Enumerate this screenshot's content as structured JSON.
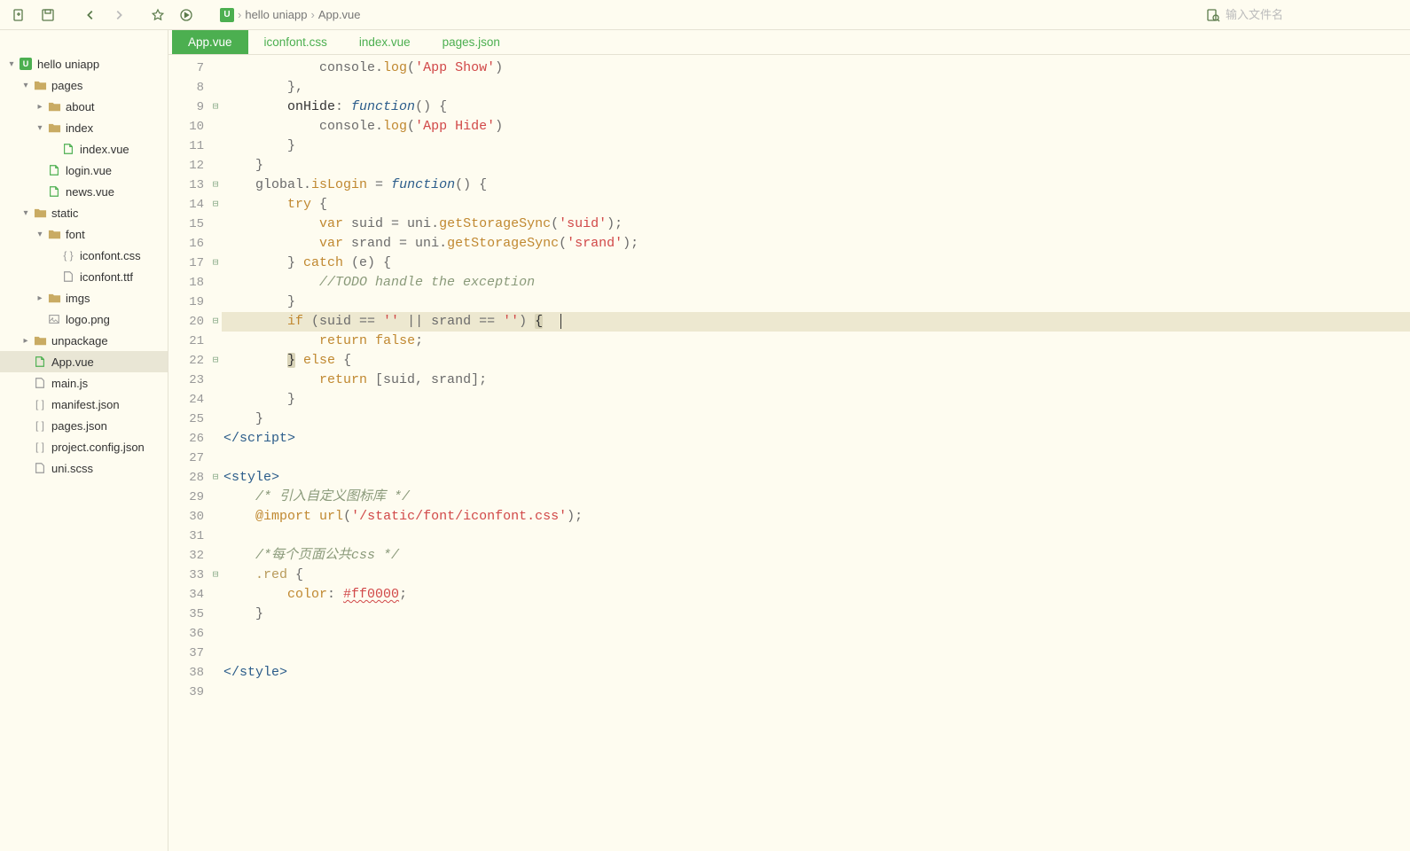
{
  "toolbar": {
    "search_placeholder": "输入文件名"
  },
  "breadcrumb": {
    "project": "hello uniapp",
    "file": "App.vue",
    "sep": "›"
  },
  "sidebar": {
    "project": "hello uniapp",
    "tree": [
      {
        "indent": 0,
        "arrow": "▾",
        "icon": "proj",
        "label": "hello uniapp"
      },
      {
        "indent": 1,
        "arrow": "▾",
        "icon": "folder",
        "label": "pages"
      },
      {
        "indent": 2,
        "arrow": "▸",
        "icon": "folder",
        "label": "about"
      },
      {
        "indent": 2,
        "arrow": "▾",
        "icon": "folder",
        "label": "index"
      },
      {
        "indent": 3,
        "arrow": "",
        "icon": "vue",
        "label": "index.vue"
      },
      {
        "indent": 2,
        "arrow": "",
        "icon": "vue",
        "label": "login.vue"
      },
      {
        "indent": 2,
        "arrow": "",
        "icon": "vue",
        "label": "news.vue"
      },
      {
        "indent": 1,
        "arrow": "▾",
        "icon": "folder",
        "label": "static"
      },
      {
        "indent": 2,
        "arrow": "▾",
        "icon": "folder",
        "label": "font"
      },
      {
        "indent": 3,
        "arrow": "",
        "icon": "css",
        "label": "iconfont.css"
      },
      {
        "indent": 3,
        "arrow": "",
        "icon": "file",
        "label": "iconfont.ttf"
      },
      {
        "indent": 2,
        "arrow": "▸",
        "icon": "folder",
        "label": "imgs"
      },
      {
        "indent": 2,
        "arrow": "",
        "icon": "img",
        "label": "logo.png"
      },
      {
        "indent": 1,
        "arrow": "▸",
        "icon": "folder",
        "label": "unpackage"
      },
      {
        "indent": 1,
        "arrow": "",
        "icon": "vue",
        "label": "App.vue",
        "active": true
      },
      {
        "indent": 1,
        "arrow": "",
        "icon": "js",
        "label": "main.js"
      },
      {
        "indent": 1,
        "arrow": "",
        "icon": "json",
        "label": "manifest.json"
      },
      {
        "indent": 1,
        "arrow": "",
        "icon": "json",
        "label": "pages.json"
      },
      {
        "indent": 1,
        "arrow": "",
        "icon": "json",
        "label": "project.config.json"
      },
      {
        "indent": 1,
        "arrow": "",
        "icon": "scss",
        "label": "uni.scss"
      }
    ]
  },
  "tabs": [
    {
      "label": "App.vue",
      "active": true
    },
    {
      "label": "iconfont.css"
    },
    {
      "label": "index.vue"
    },
    {
      "label": "pages.json"
    }
  ],
  "code": {
    "first_line_no": 7,
    "highlighted_index": 13,
    "lines": [
      {
        "fold": "",
        "segs": [
          [
            "            console.",
            "c-default"
          ],
          [
            "log",
            "c-method"
          ],
          [
            "(",
            "c-punct"
          ],
          [
            "'App Show'",
            "c-string"
          ],
          [
            ")",
            "c-punct"
          ]
        ]
      },
      {
        "fold": "",
        "segs": [
          [
            "        },",
            "c-punct"
          ]
        ]
      },
      {
        "fold": "⊟",
        "segs": [
          [
            "        onHide",
            "c-prop"
          ],
          [
            ": ",
            "c-punct"
          ],
          [
            "function",
            "c-func"
          ],
          [
            "() {",
            "c-punct"
          ]
        ]
      },
      {
        "fold": "",
        "segs": [
          [
            "            console.",
            "c-default"
          ],
          [
            "log",
            "c-method"
          ],
          [
            "(",
            "c-punct"
          ],
          [
            "'App Hide'",
            "c-string"
          ],
          [
            ")",
            "c-punct"
          ]
        ]
      },
      {
        "fold": "",
        "segs": [
          [
            "        }",
            "c-punct"
          ]
        ]
      },
      {
        "fold": "",
        "segs": [
          [
            "    }",
            "c-punct"
          ]
        ]
      },
      {
        "fold": "⊟",
        "segs": [
          [
            "    global.",
            "c-default"
          ],
          [
            "isLogin",
            "c-method"
          ],
          [
            " = ",
            "c-punct"
          ],
          [
            "function",
            "c-func"
          ],
          [
            "() {",
            "c-punct"
          ]
        ]
      },
      {
        "fold": "⊟",
        "segs": [
          [
            "        ",
            "c-default"
          ],
          [
            "try",
            "c-keyword2"
          ],
          [
            " {",
            "c-punct"
          ]
        ]
      },
      {
        "fold": "",
        "segs": [
          [
            "            ",
            "c-default"
          ],
          [
            "var",
            "c-keyword2"
          ],
          [
            " suid = uni.",
            "c-default"
          ],
          [
            "getStorageSync",
            "c-method"
          ],
          [
            "(",
            "c-punct"
          ],
          [
            "'suid'",
            "c-string"
          ],
          [
            ");",
            "c-punct"
          ]
        ]
      },
      {
        "fold": "",
        "segs": [
          [
            "            ",
            "c-default"
          ],
          [
            "var",
            "c-keyword2"
          ],
          [
            " srand = uni.",
            "c-default"
          ],
          [
            "getStorageSync",
            "c-method"
          ],
          [
            "(",
            "c-punct"
          ],
          [
            "'srand'",
            "c-string"
          ],
          [
            ");",
            "c-punct"
          ]
        ]
      },
      {
        "fold": "⊟",
        "segs": [
          [
            "        } ",
            "c-punct"
          ],
          [
            "catch",
            "c-keyword2"
          ],
          [
            " (e) {",
            "c-punct"
          ]
        ]
      },
      {
        "fold": "",
        "segs": [
          [
            "            ",
            "c-default"
          ],
          [
            "//TODO handle the exception",
            "c-comment"
          ]
        ]
      },
      {
        "fold": "",
        "segs": [
          [
            "        }",
            "c-punct"
          ]
        ]
      },
      {
        "fold": "⊟",
        "segs": [
          [
            "        ",
            "c-default"
          ],
          [
            "if",
            "c-keyword2"
          ],
          [
            " (suid == ",
            "c-default"
          ],
          [
            "''",
            "c-string"
          ],
          [
            " || srand == ",
            "c-default"
          ],
          [
            "''",
            "c-string"
          ],
          [
            ") ",
            "c-default"
          ],
          [
            "{",
            "bracket-match"
          ]
        ]
      },
      {
        "fold": "",
        "segs": [
          [
            "            ",
            "c-default"
          ],
          [
            "return",
            "c-keyword2"
          ],
          [
            " ",
            "c-default"
          ],
          [
            "false",
            "c-keyword2"
          ],
          [
            ";",
            "c-punct"
          ]
        ]
      },
      {
        "fold": "⊟",
        "segs": [
          [
            "        ",
            "c-default"
          ],
          [
            "}",
            "bracket-match"
          ],
          [
            " ",
            "c-default"
          ],
          [
            "else",
            "c-keyword2"
          ],
          [
            " {",
            "c-punct"
          ]
        ]
      },
      {
        "fold": "",
        "segs": [
          [
            "            ",
            "c-default"
          ],
          [
            "return",
            "c-keyword2"
          ],
          [
            " [suid, srand];",
            "c-default"
          ]
        ]
      },
      {
        "fold": "",
        "segs": [
          [
            "        }",
            "c-punct"
          ]
        ]
      },
      {
        "fold": "",
        "segs": [
          [
            "    }",
            "c-punct"
          ]
        ]
      },
      {
        "fold": "",
        "segs": [
          [
            "</",
            "c-tag"
          ],
          [
            "script",
            "c-tag"
          ],
          [
            ">",
            "c-tag"
          ]
        ]
      },
      {
        "fold": "",
        "segs": [
          [
            "",
            ""
          ]
        ]
      },
      {
        "fold": "⊟",
        "segs": [
          [
            "<",
            "c-tag"
          ],
          [
            "style",
            "c-tag"
          ],
          [
            ">",
            "c-tag"
          ]
        ]
      },
      {
        "fold": "",
        "segs": [
          [
            "    ",
            "c-default"
          ],
          [
            "/* 引入自定义图标库 */",
            "c-comment"
          ]
        ]
      },
      {
        "fold": "",
        "segs": [
          [
            "    ",
            "c-default"
          ],
          [
            "@import",
            "c-css-import"
          ],
          [
            " ",
            "c-default"
          ],
          [
            "url",
            "c-url"
          ],
          [
            "(",
            "c-punct"
          ],
          [
            "'/static/font/iconfont.css'",
            "c-string"
          ],
          [
            ");",
            "c-punct"
          ]
        ]
      },
      {
        "fold": "",
        "segs": [
          [
            "",
            ""
          ]
        ]
      },
      {
        "fold": "",
        "segs": [
          [
            "    ",
            "c-default"
          ],
          [
            "/*每个页面公共css */",
            "c-comment"
          ]
        ]
      },
      {
        "fold": "⊟",
        "segs": [
          [
            "    ",
            "c-default"
          ],
          [
            ".red",
            "c-selector"
          ],
          [
            " {",
            "c-punct"
          ]
        ]
      },
      {
        "fold": "",
        "segs": [
          [
            "        ",
            "c-default"
          ],
          [
            "color",
            "c-attr"
          ],
          [
            ": ",
            "c-punct"
          ],
          [
            "#ff0000",
            "c-color"
          ],
          [
            ";",
            "c-punct"
          ]
        ]
      },
      {
        "fold": "",
        "segs": [
          [
            "    }",
            "c-punct"
          ]
        ]
      },
      {
        "fold": "",
        "segs": [
          [
            "",
            ""
          ]
        ]
      },
      {
        "fold": "",
        "segs": [
          [
            "",
            ""
          ]
        ]
      },
      {
        "fold": "",
        "segs": [
          [
            "</",
            "c-tag"
          ],
          [
            "style",
            "c-tag"
          ],
          [
            ">",
            "c-tag"
          ]
        ]
      },
      {
        "fold": "",
        "segs": [
          [
            "",
            ""
          ]
        ]
      }
    ]
  }
}
